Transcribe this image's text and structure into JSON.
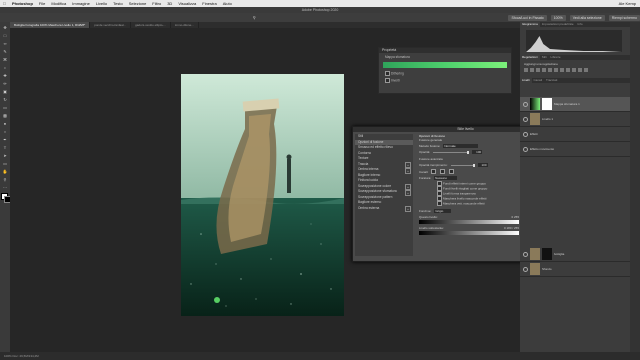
{
  "menubar": {
    "app": "Photoshop",
    "items": [
      "File",
      "Modifica",
      "Immagine",
      "Livello",
      "Testo",
      "Selezione",
      "Filtro",
      "3D",
      "Visualizza",
      "Finestra",
      "Aiuto"
    ],
    "right": "Ale Kemp"
  },
  "window_title": "Adobe Photoshop 2020",
  "options_bar": {
    "buttons": [
      "Sfoca/Luci in Fissato",
      "100%",
      "Vedi alla selezione",
      "Riempi schermo"
    ],
    "labels": [
      "Visto 100%"
    ]
  },
  "tabs": [
    {
      "label": "Bottiglia Fotografia 100% Maschera Livello 1, RGB/8*",
      "active": true
    },
    {
      "label": "ponde vecchio-fanfaal...",
      "active": false
    },
    {
      "label": "gadoni-vestito ellipto-...",
      "active": false
    },
    {
      "label": "immo-dilone...",
      "active": false
    }
  ],
  "properties": {
    "title": "Proprietà",
    "subtitle": "Mappa sfumatura",
    "lines": [
      "Dithering",
      "Inverti"
    ]
  },
  "dialog": {
    "title": "Stile livello",
    "left_items": [
      {
        "label": "Stili",
        "selected": false,
        "plus": false
      },
      {
        "label": "Opzioni di fusione",
        "selected": true,
        "plus": false
      },
      {
        "label": "Smusso ed effetto rilievo",
        "selected": false,
        "plus": false
      },
      {
        "label": "Contorno",
        "selected": false,
        "plus": false
      },
      {
        "label": "Texture",
        "selected": false,
        "plus": false
      },
      {
        "label": "Traccia",
        "selected": false,
        "plus": true
      },
      {
        "label": "Ombra interna",
        "selected": false,
        "plus": true
      },
      {
        "label": "Bagliore interno",
        "selected": false,
        "plus": false
      },
      {
        "label": "Finitura lucida",
        "selected": false,
        "plus": false
      },
      {
        "label": "Sovrapposizione colore",
        "selected": false,
        "plus": true
      },
      {
        "label": "Sovrapposizione sfumatura",
        "selected": false,
        "plus": true
      },
      {
        "label": "Sovrapposizione pattern",
        "selected": false,
        "plus": false
      },
      {
        "label": "Bagliore esterno",
        "selected": false,
        "plus": false
      },
      {
        "label": "Ombra esterna",
        "selected": false,
        "plus": true
      }
    ],
    "mid": {
      "section1": "Opzioni di fusione",
      "section1b": "Fusione generale",
      "blend_label": "Metodo fusione:",
      "blend_value": "Normale",
      "opacity_label": "Opacità:",
      "opacity_value": "100",
      "section2": "Fusione avanzata",
      "fill_label": "Opacità riempimento:",
      "fill_value": "100",
      "channels_label": "Canali:",
      "knockout_label": "Foratura:",
      "knockout_value": "Nessuno",
      "checks": [
        "Fondi effetti interni come gruppo",
        "Fondi livelli ritagliati come gruppo",
        "Livelli forma trasparenza",
        "Maschera livello nasconde effetti",
        "Maschera vett. nasconde effetti"
      ],
      "blendif_label": "Fondi se:",
      "blendif_value": "Grigio",
      "this_layer": "Questo livello:",
      "this_layer_range": "0   255",
      "below_layer": "Livello sottostante:",
      "below_layer_range": "0   180 / 255"
    },
    "buttons": {
      "ok": "OK",
      "cancel": "Annulla",
      "new_style": "Nuovo stile...",
      "preview": "Anteprima"
    }
  },
  "right_panels": {
    "histogram_tabs": [
      "Istogramma",
      "Impostazioni predefinite",
      "Info"
    ],
    "adjust_tabs": [
      "Regolazioni",
      "Stili",
      "Librerie"
    ],
    "adjust_subtitle": "Aggiungi una regolazione",
    "layers_tabs": [
      "Livelli",
      "Canali",
      "Tracciati"
    ],
    "layers": [
      {
        "name": "Mappa sfumatura 1"
      },
      {
        "name": "Livello 1"
      },
      {
        "name": "Effetti"
      },
      {
        "name": "Effetto movimento"
      },
      {
        "name": "bottiglia"
      },
      {
        "name": "Sfondo"
      }
    ]
  },
  "status": "100%   Doc: 29,5M/134,2M"
}
